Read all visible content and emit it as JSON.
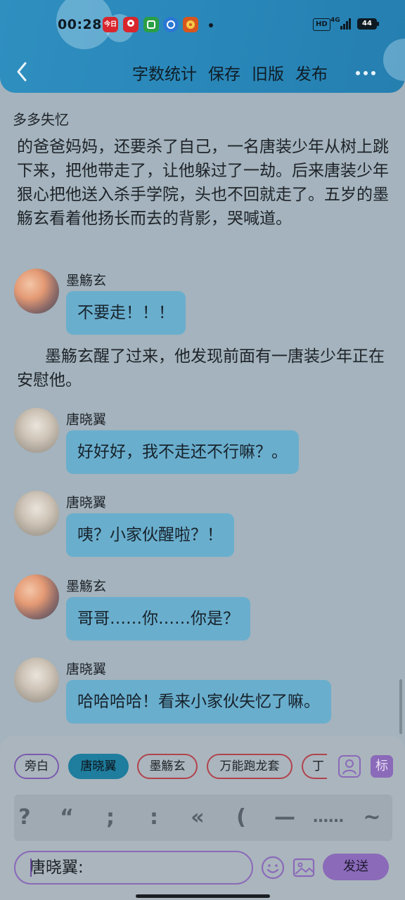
{
  "status_bar": {
    "time": "00:28",
    "app_icons": [
      {
        "name": "news-app-icon",
        "label": "今日",
        "color": "#d8262c"
      },
      {
        "name": "red-location-icon",
        "label": "",
        "color": "#d8262c"
      },
      {
        "name": "green-app-icon",
        "label": "",
        "color": "#2a9f45"
      },
      {
        "name": "blue-app-icon",
        "label": "",
        "color": "#2a77d4"
      },
      {
        "name": "orange-app-icon",
        "label": "",
        "color": "#d7561e"
      }
    ],
    "hd": "HD",
    "network": "4G",
    "battery": "44"
  },
  "header": {
    "actions": [
      "字数统计",
      "保存",
      "旧版",
      "发布"
    ]
  },
  "chat": {
    "title": "多多失忆",
    "narration_1": "的爸爸妈妈，还要杀了自己，一名唐装少年从树上跳下来，把他带走了，让他躲过了一劫。后来唐装少年狠心把他送入杀手学院，头也不回就走了。五岁的墨觞玄看着他扬长而去的背影，哭喊道。",
    "narration_2": "墨觞玄醒了过来，他发现前面有一唐装少年正在安慰他。",
    "messages": [
      {
        "speaker": "墨觞玄",
        "text": "不要走！！！"
      },
      {
        "speaker": "唐晓翼",
        "text": "好好好，我不走还不行嘛？。"
      },
      {
        "speaker": "唐晓翼",
        "text": "咦？小家伙醒啦？！"
      },
      {
        "speaker": "墨觞玄",
        "text": "哥哥……你……你是？"
      },
      {
        "speaker": "唐晓翼",
        "text": "哈哈哈哈！看来小家伙失忆了嘛。"
      }
    ]
  },
  "roles": [
    "旁白",
    "唐晓翼",
    "墨觞玄",
    "万能跑龙套",
    "丁"
  ],
  "mark_label": "标",
  "punctuation": [
    "?",
    "“",
    ";",
    ":",
    "«",
    "(",
    "—",
    "……",
    "~"
  ],
  "input": {
    "value": "唐晓翼:"
  },
  "send_label": "发送",
  "colors": {
    "accent": "#8a6ab9",
    "header": "#2a88ba",
    "bubble": "#6aaecd",
    "active_role": "#1f7d9e",
    "role_border": "#b0434d"
  }
}
